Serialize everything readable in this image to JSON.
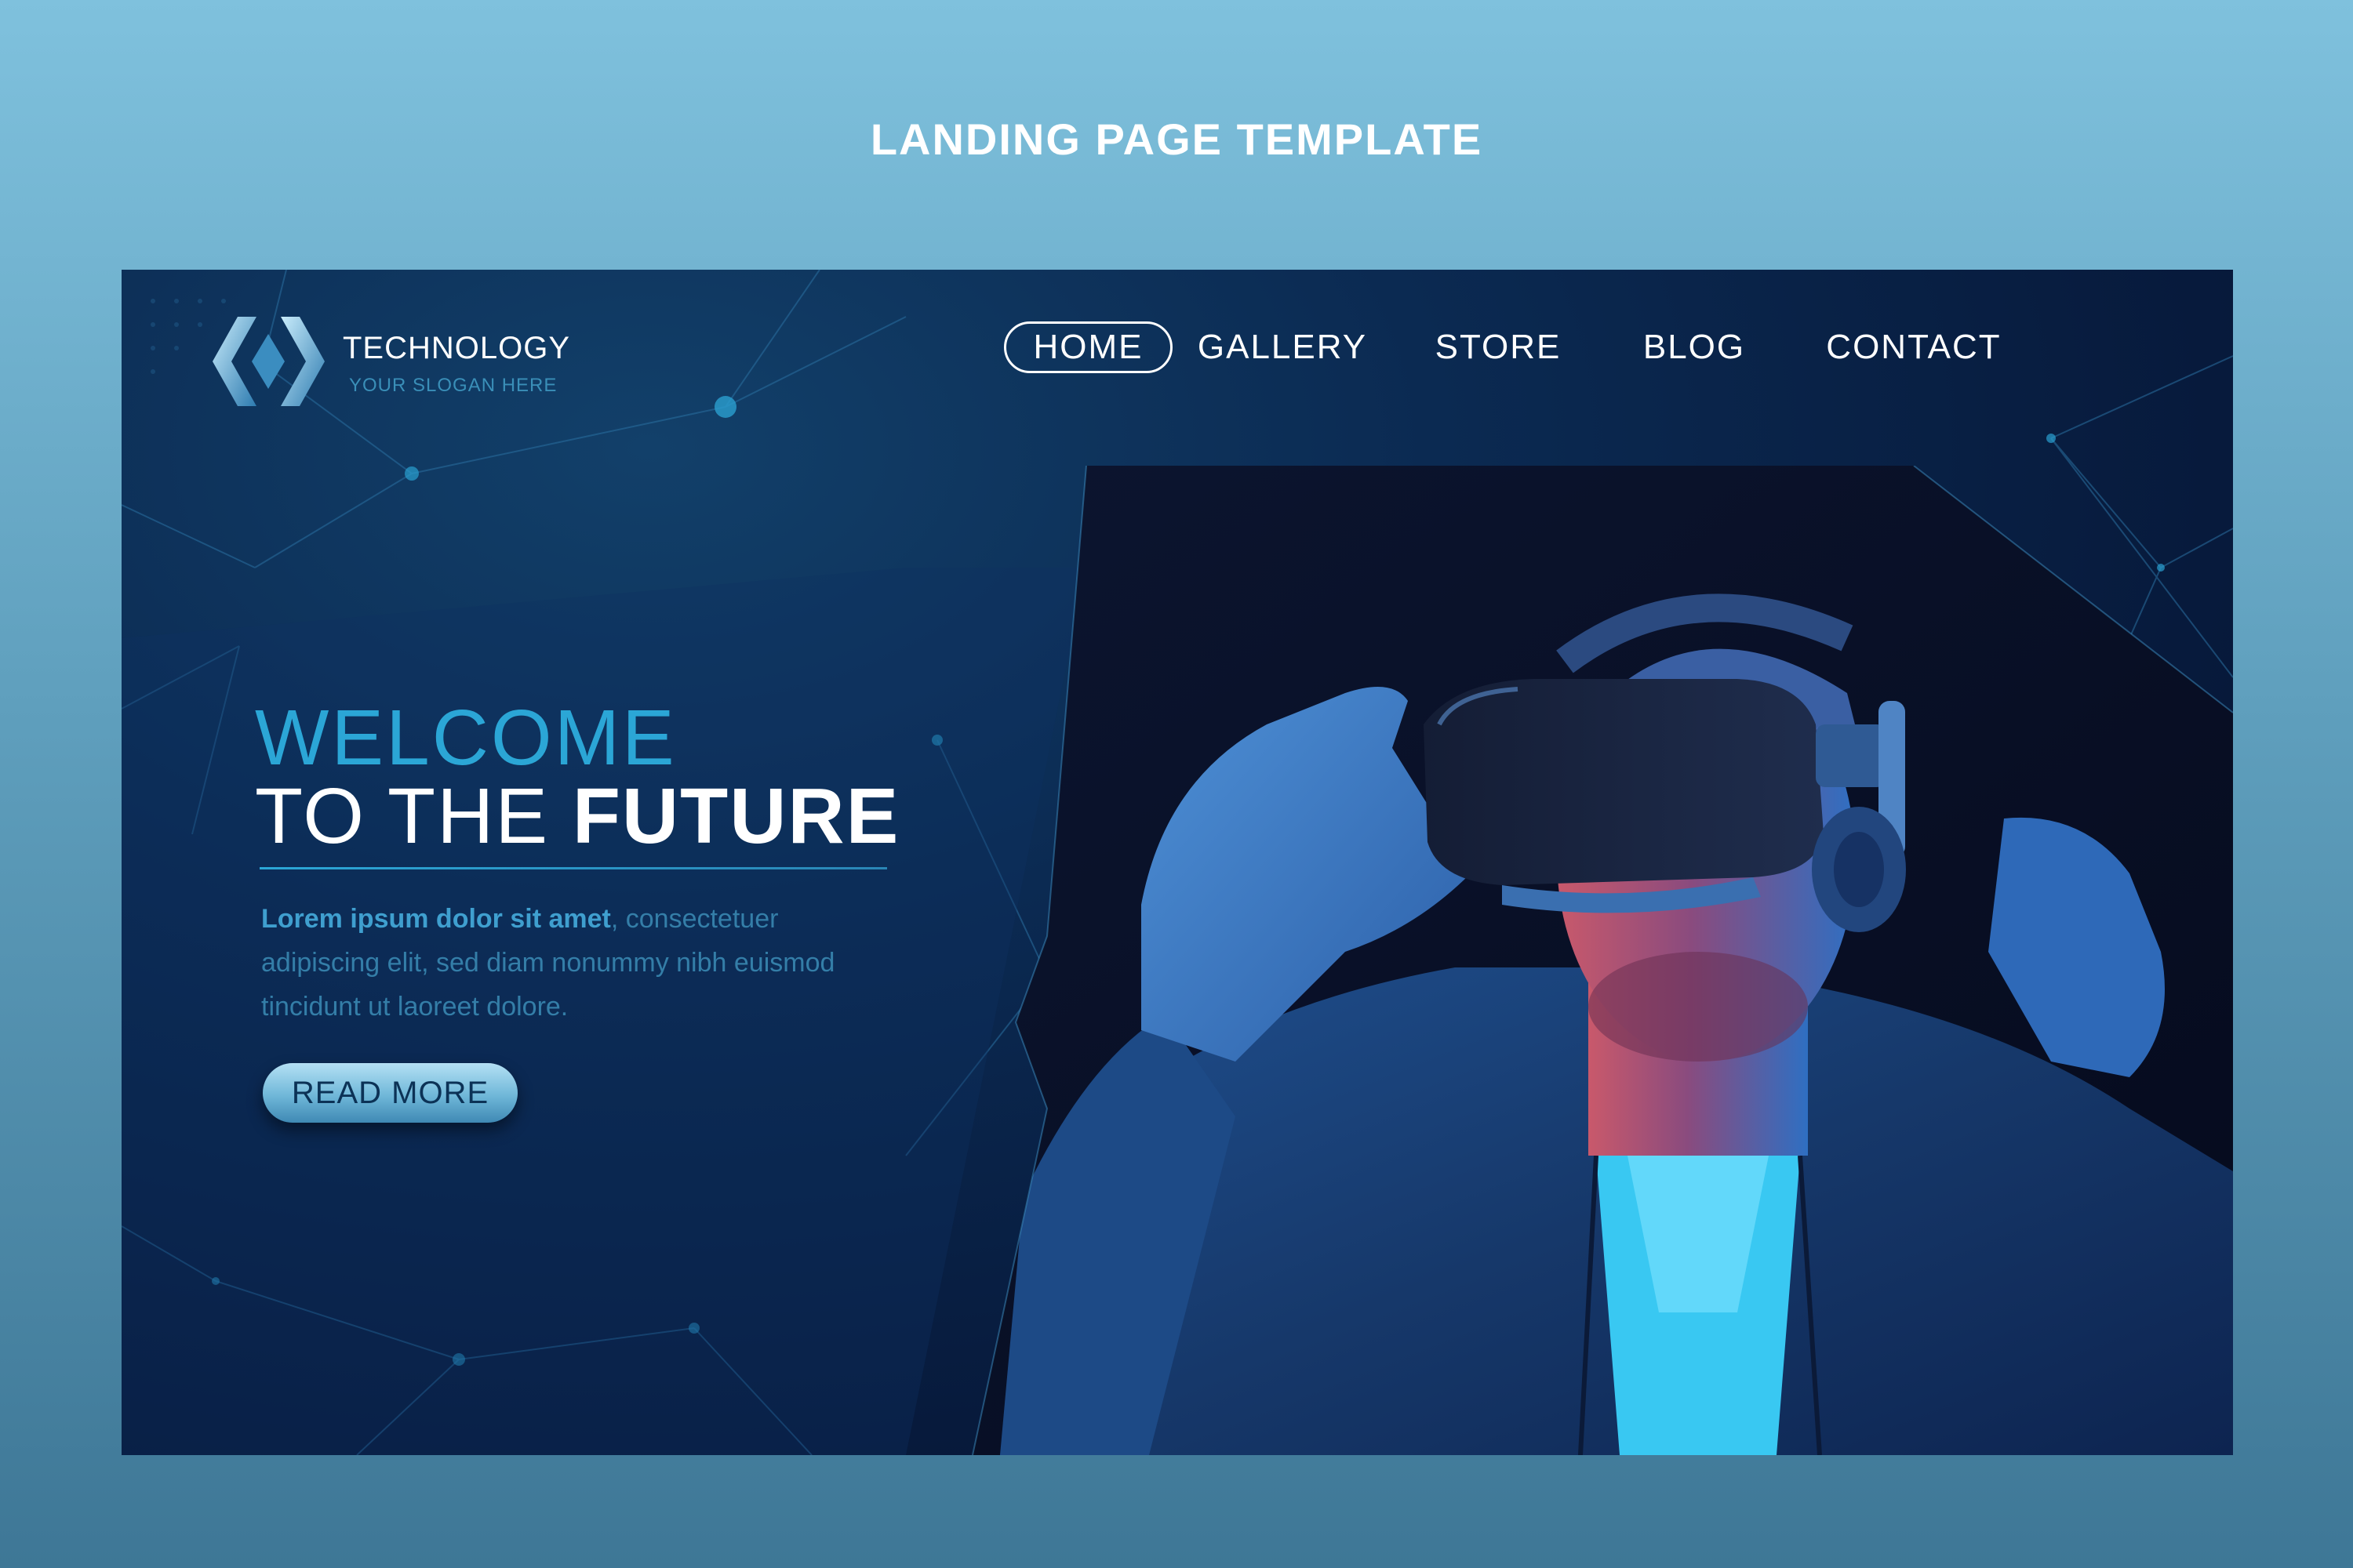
{
  "page_caption": "LANDING PAGE TEMPLATE",
  "brand": {
    "name": "TECHNOLOGY",
    "slogan": "YOUR SLOGAN HERE"
  },
  "nav": {
    "items": [
      {
        "label": "HOME",
        "active": true
      },
      {
        "label": "GALLERY",
        "active": false
      },
      {
        "label": "STORE",
        "active": false
      },
      {
        "label": "BLOG",
        "active": false
      },
      {
        "label": "CONTACT",
        "active": false
      }
    ]
  },
  "hero": {
    "line1": "WELCOME",
    "line2_prefix": "TO THE ",
    "line2_bold": "FUTURE",
    "body_lead": "Lorem ipsum dolor sit amet",
    "body_rest": ", consectetuer adipiscing elit, sed diam nonummy nibh euismod tincidunt ut laoreet dolore.",
    "cta_label": "READ MORE"
  },
  "colors": {
    "background_top": "#7fc1dd",
    "frame_dark": "#071a3c",
    "accent_cyan": "#2ba6d6",
    "button_light": "#b4e0f4"
  }
}
